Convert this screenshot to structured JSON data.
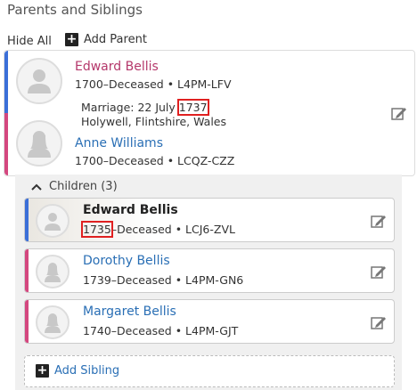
{
  "section_title": "Parents and Siblings",
  "hide_all": "Hide All",
  "add_parent": "Add Parent",
  "father": {
    "name": "Edward Bellis",
    "meta": "1700–Deceased • L4PM-LFV"
  },
  "marriage": {
    "prefix": "Marriage: 22 July ",
    "year": "1737",
    "place": "Holywell, Flintshire, Wales"
  },
  "mother": {
    "name": "Anne Williams",
    "meta": "1700–Deceased • LCQZ-CZZ"
  },
  "children_header": "Children (3)",
  "children": [
    {
      "name": "Edward Bellis",
      "year": "1735",
      "rest": "–Deceased • LCJ6-ZVL",
      "bar": "#3b6fd8"
    },
    {
      "name": "Dorothy Bellis",
      "meta": "1739–Deceased • L4PM-GN6",
      "bar": "#d4477f"
    },
    {
      "name": "Margaret Bellis",
      "meta": "1740–Deceased • L4PM-GJT",
      "bar": "#d4477f"
    }
  ],
  "add_sibling": "Add Sibling",
  "colors": {
    "male_bar": "#3b6fd8",
    "female_bar": "#d4477f",
    "link_blue": "#2a6fb5",
    "father_name": "#b5386b",
    "highlight": "#e02020"
  }
}
